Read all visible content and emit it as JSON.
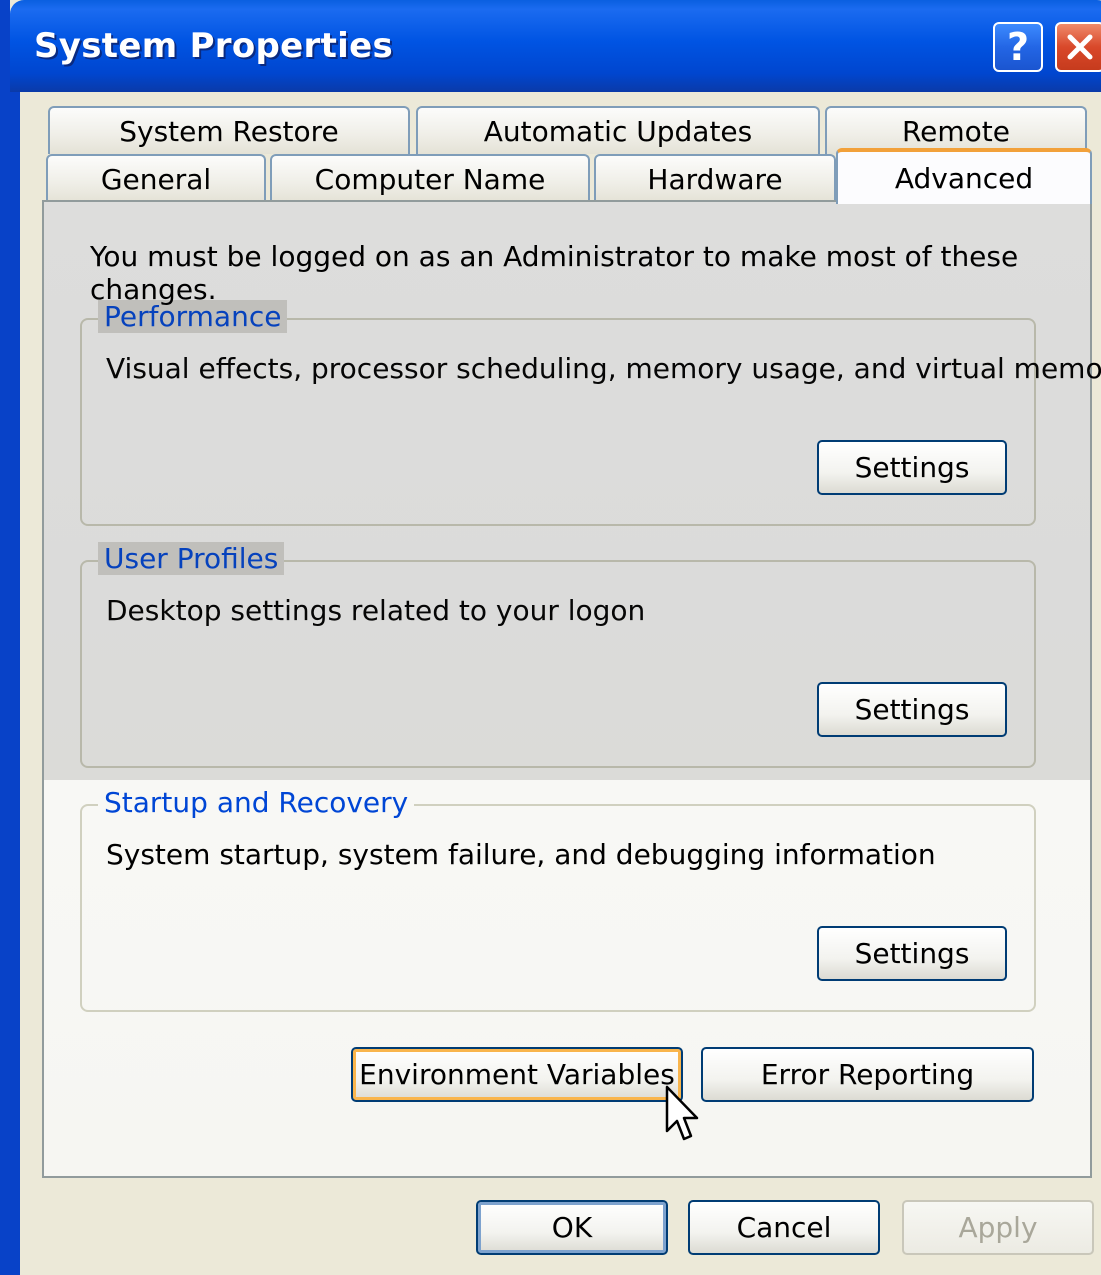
{
  "window": {
    "title": "System Properties",
    "help_label": "?",
    "close_icon": "close-icon"
  },
  "tabs": {
    "row1": [
      "System Restore",
      "Automatic Updates",
      "Remote"
    ],
    "row2": [
      "General",
      "Computer Name",
      "Hardware",
      "Advanced"
    ],
    "active": "Advanced"
  },
  "main": {
    "note": "You must be logged on as an Administrator to make most of these changes.",
    "performance": {
      "title": "Performance",
      "description": "Visual effects, processor scheduling, memory usage, and virtual memory",
      "button": "Settings"
    },
    "user_profiles": {
      "title": "User Profiles",
      "description": "Desktop settings related to your logon",
      "button": "Settings"
    },
    "startup_recovery": {
      "title": "Startup and Recovery",
      "description": "System startup, system failure, and debugging information",
      "button": "Settings"
    },
    "env_button": "Environment Variables",
    "error_button": "Error Reporting"
  },
  "footer": {
    "ok": "OK",
    "cancel": "Cancel",
    "apply": "Apply"
  },
  "colors": {
    "title_bar": "#0054e3",
    "group_title": "#0046d5",
    "active_tab_accent": "#f2a13a",
    "focus_ring": "#f9b54c"
  }
}
